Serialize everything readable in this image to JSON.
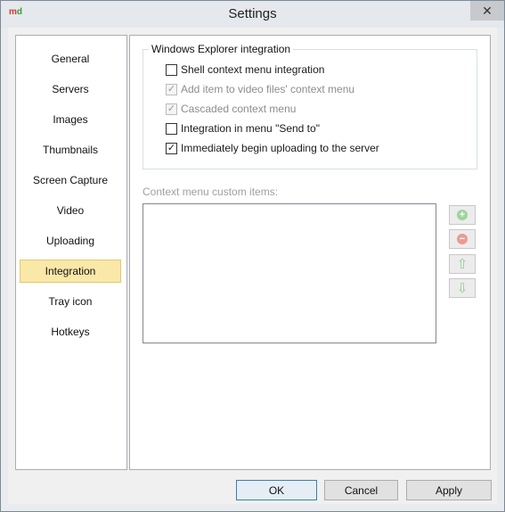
{
  "window": {
    "title": "Settings",
    "close_glyph": "✕"
  },
  "app_icon": {
    "m": "m",
    "d": "d"
  },
  "sidebar": {
    "items": [
      {
        "label": "General"
      },
      {
        "label": "Servers"
      },
      {
        "label": "Images"
      },
      {
        "label": "Thumbnails"
      },
      {
        "label": "Screen Capture"
      },
      {
        "label": "Video"
      },
      {
        "label": "Uploading"
      },
      {
        "label": "Integration",
        "selected": true
      },
      {
        "label": "Tray icon"
      },
      {
        "label": "Hotkeys"
      }
    ]
  },
  "integration": {
    "group_title": "Windows Explorer integration",
    "options": [
      {
        "label": "Shell context menu integration",
        "checked": false,
        "enabled": true
      },
      {
        "label": "Add item to video files' context menu",
        "checked": true,
        "enabled": false
      },
      {
        "label": "Cascaded context menu",
        "checked": true,
        "enabled": false
      },
      {
        "label": "Integration in menu \"Send to\"",
        "checked": false,
        "enabled": true
      },
      {
        "label": "Immediately begin uploading to the server",
        "checked": true,
        "enabled": true
      }
    ],
    "custom_items_label": "Context menu custom items:",
    "custom_items": [],
    "side_buttons": [
      {
        "icon": "add-icon",
        "glyph": "+"
      },
      {
        "icon": "remove-icon",
        "glyph": "−"
      },
      {
        "icon": "arrow-up-icon",
        "glyph": "⇧"
      },
      {
        "icon": "arrow-down-icon",
        "glyph": "⇩"
      }
    ]
  },
  "footer": {
    "ok_label": "OK",
    "cancel_label": "Cancel",
    "apply_label": "Apply"
  },
  "colors": {
    "selection": "#fae8a8",
    "add_green": "#9fd49a",
    "remove_red": "#eb9a92"
  }
}
